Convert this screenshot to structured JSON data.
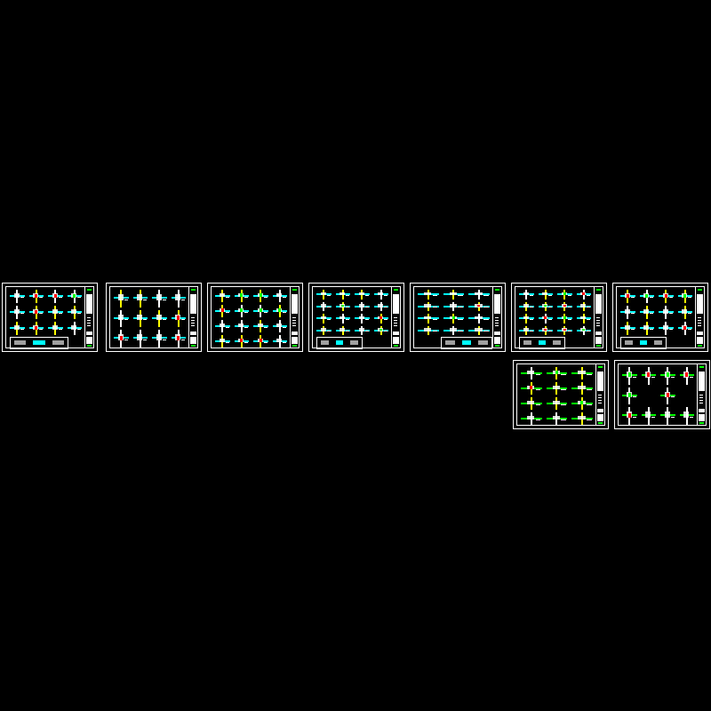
{
  "canvas": {
    "background": "#000000",
    "frame_color": "#ffffff"
  },
  "palette": {
    "white": "#ffffff",
    "cyan": "#00ffff",
    "yellow": "#ffff00",
    "green": "#00ff00",
    "red": "#ff0000",
    "gray": "#a0a0a0",
    "magenta": "#ff00ff"
  },
  "sheets": [
    {
      "id": "sheet-1",
      "rows": 3,
      "cols": 4,
      "callout": "bottom-wide"
    },
    {
      "id": "sheet-2",
      "rows": 3,
      "cols": 4,
      "callout": "none"
    },
    {
      "id": "sheet-3",
      "rows": 4,
      "cols": 4,
      "callout": "none"
    },
    {
      "id": "sheet-4",
      "rows": 4,
      "cols": 4,
      "callout": "bottom-left"
    },
    {
      "id": "sheet-5",
      "rows": 4,
      "cols": 3,
      "callout": "bottom-right"
    },
    {
      "id": "sheet-6",
      "rows": 4,
      "cols": 4,
      "callout": "bottom-left"
    },
    {
      "id": "sheet-7",
      "rows": 3,
      "cols": 4,
      "callout": "bottom-left"
    },
    {
      "id": "sheet-8",
      "rows": 4,
      "cols": 3,
      "callout": "none",
      "style": "plan"
    },
    {
      "id": "sheet-9",
      "rows": 3,
      "cols": 4,
      "callout": "none",
      "style": "sparse"
    }
  ]
}
